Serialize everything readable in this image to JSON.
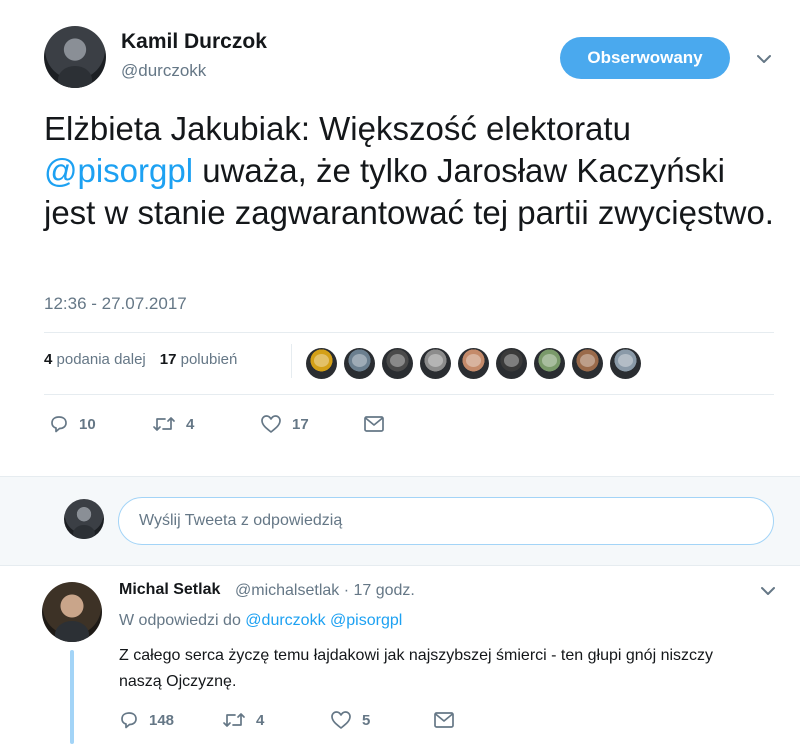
{
  "tweet": {
    "author_name": "Kamil Durczok",
    "author_handle": "@durczokk",
    "follow_label": "Obserwowany",
    "text_part1": "Elżbieta Jakubiak: Większość elektoratu ",
    "mention": "@pisorgpl",
    "text_part2": " uważa, że tylko Jarosław Kaczyński jest w stanie zagwarantować tej partii zwycięstwo.",
    "time": "12:36 - 27.07.2017",
    "retweets_count": "4",
    "retweets_label": "podania dalej",
    "likes_count": "17",
    "likes_label": "polubień",
    "actions": {
      "replies": "10",
      "retweets": "4",
      "likes": "17"
    }
  },
  "likers": [
    {
      "color": "#d4a017"
    },
    {
      "color": "#6b7f8f"
    },
    {
      "color": "#4a4a4a"
    },
    {
      "color": "#8c8c8c"
    },
    {
      "color": "#c48a6a"
    },
    {
      "color": "#3a3a3a"
    },
    {
      "color": "#7a9a6a"
    },
    {
      "color": "#9a6a4a"
    },
    {
      "color": "#8a9aa8"
    }
  ],
  "reply_box": {
    "placeholder": "Wyślij Tweeta z odpowiedzią"
  },
  "reply": {
    "author_name": "Michal Setlak",
    "meta": "@michalsetlak · 17 godz.",
    "reply_to_label": "W odpowiedzi do",
    "reply_to_1": "@durczokk",
    "reply_to_2": "@pisorgpl",
    "text": "Z całego serca życzę temu łajdakowi jak najszybszej śmierci - ten głupi gnój niszczy naszą Ojczyznę.",
    "actions": {
      "replies": "148",
      "retweets": "4",
      "likes": "5"
    }
  },
  "colors": {
    "accent": "#1da1f2",
    "follow_button": "#4aa9ee",
    "muted_text": "#657786"
  }
}
